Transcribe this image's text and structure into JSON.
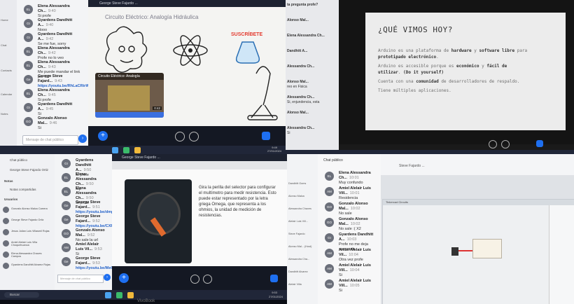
{
  "q1": {
    "chat_rows": [
      {
        "name": "Elena Alessandra Ch...",
        "time": "9:40",
        "text": "Si profe",
        "avatar": "EL"
      },
      {
        "name": "Gyardens Dandhitt A...",
        "time": "9:40",
        "text": "Nooo",
        "avatar": "GI"
      },
      {
        "name": "Gyardens Dandhitt A...",
        "time": "9:42",
        "text": "Se me fue, sorry",
        "avatar": "GI"
      },
      {
        "name": "Elena Alessandra Ch...",
        "time": "9:42",
        "text": "Profe no lo veo",
        "avatar": "EL"
      },
      {
        "name": "Elena Alessandra Ch...",
        "time": "9:43",
        "text": "Me puede mandar el link por fa?",
        "avatar": "EL"
      },
      {
        "name": "George Steve Fajard...",
        "time": "9:43",
        "text": "https://youtu.be/RhLaCRtrWH",
        "avatar": "Ge",
        "link": true
      },
      {
        "name": "Elena Alessandra Ch...",
        "time": "9:45",
        "text": "Si profe",
        "avatar": "EL"
      },
      {
        "name": "Gyardens Dandhitt A...",
        "time": "9:45",
        "text": "Si",
        "avatar": "GI"
      },
      {
        "name": "Gonzalo Alonso Mal...",
        "time": "9:46",
        "text": "Si",
        "avatar": "GO"
      }
    ],
    "sidebar_labels": [
      "Home",
      "Chat",
      "Contacts",
      "Calendar",
      "Notes"
    ],
    "input_placeholder": "Mensaje de chat público",
    "meeting_title": "George Steve Fajardo ...",
    "video_title": "Circuito Eléctrico: Analogía Hidráulica",
    "sticker_text": "SUSCRÍBETE",
    "thumb_title": "Circuito Eléctrico: Analogía",
    "thumb_time": "0:42",
    "tray_lang": "ESP\nLAA",
    "tray_time": "9:49",
    "tray_date": "27/01/2024"
  },
  "q2": {
    "chat_names": [
      "ta pregunta profe?",
      "Alonso Mal...",
      "Elena Alessandra Ch...",
      "Dandhitt A...",
      "Alessandra Ch...",
      "Alonso Mal...",
      "Alessandra Ch...",
      "Alonso Mal...",
      "Alessandra Ch..."
    ],
    "chat_snips": [
      "",
      "",
      "",
      "",
      "",
      "reo en Fisica",
      "Si, enjundencia, esta",
      "",
      "Si"
    ],
    "slide_title": "¿QUÉ VIMOS HOY?",
    "slide_lines": [
      [
        "Arduino es una plataforma de ",
        "hardware",
        " y ",
        "software libre",
        " para"
      ],
      [
        "prototipado electrónico",
        "."
      ],
      [
        "Arduino es accesible porque es ",
        "económico",
        " y ",
        "fácil de"
      ],
      [
        "utilizar",
        ". ",
        "(Do it yourself)"
      ],
      [
        "Cuenta con una ",
        "comunidad",
        " de desarrolladores de respaldo."
      ],
      [
        "Tiene múltiples aplicaciones."
      ]
    ]
  },
  "q3": {
    "meeting_title": "George Steve Fajardo ...",
    "left_nav": [
      "Chat público",
      "George Steve Fajardo Ortiz",
      "Notas",
      "Notas compartidas",
      "Usuarios"
    ],
    "users": [
      "Gonzalo Alonso Malca Carrera",
      "George Steve Fajardo Ortiz",
      "Jesus Julian Luis Villasmil Rojas",
      "Amiel Alelair Luis Villa Choquehuanca",
      "Elena Alessandra Chaves Campos",
      "Gyardens Dandhitt Alvarez Rojas"
    ],
    "chat_rows": [
      {
        "name": "Gyardens Dandhitt A...",
        "time": "9:50",
        "text": "Si profe",
        "avatar": "GI"
      },
      {
        "name": "Elena Alessandra Ch...",
        "time": "9:50",
        "text": "Sip",
        "avatar": "EL"
      },
      {
        "name": "Elena Alessandra Ch...",
        "time": "9:50",
        "text": "Si profe",
        "avatar": "EL"
      },
      {
        "name": "George Steve Fajard...",
        "time": "9:51",
        "text": "https://youtu.be/dmpfCqAddI",
        "avatar": "Ge",
        "link": true
      },
      {
        "name": "George Steve Fajard...",
        "time": "9:52",
        "text": "https://youtu.be/CXROPPvW",
        "avatar": "Ge",
        "link": true
      },
      {
        "name": "Gonzalo Alonso Mal...",
        "time": "9:52",
        "text": "No sale la url",
        "avatar": "GO"
      },
      {
        "name": "Amiel Alelair Luis Vil...",
        "time": "9:53",
        "text": "Si",
        "avatar": "AM"
      },
      {
        "name": "George Steve Fajard...",
        "time": "9:53",
        "text": "https://youtu.be/MeQ5pKfGrf",
        "avatar": "Ge",
        "link": true
      }
    ],
    "input_placeholder": "Mensaje de chat público",
    "slide_text": "Gira la perilla del selector para configurar el multímetro para medir resistencia. Esto puede estar representado por la letra griega Omega, que representa a los ohmios, la unidad de medición de resistencias.",
    "search_placeholder": "Buscar",
    "brand": "VivoBook",
    "tray_time": "9:53",
    "tray_date": "27/01/2024"
  },
  "q4": {
    "chat_header": "Chat público",
    "left_names": [
      "Dandhitt Goms",
      "Alonso Malca",
      "Alessandra Chaves",
      "Alelair Luis Vill...",
      "Steve Fajardo",
      "Alonso Mal... (Host)",
      "Alessandra Cha...",
      "Dandhitt Alvarez",
      "Alelair Villa"
    ],
    "chat_rows": [
      {
        "name": "Elena Alessandra Ch...",
        "time": "10:01",
        "text": "Muy confundo",
        "avatar": "EL"
      },
      {
        "name": "Amiel Alelair Luis Vill...",
        "time": "10:01",
        "text": "Residencia",
        "avatar": "AM"
      },
      {
        "name": "Gonzalo Alonso Mal...",
        "time": "10:02",
        "text": "No sale",
        "avatar": "GO"
      },
      {
        "name": "Gonzalo Alonso Mal...",
        "time": "10:02",
        "text": "No sale :( X2",
        "avatar": "GO"
      },
      {
        "name": "Gyardens Dandhitt A...",
        "time": "10:03",
        "text": "Profe no me deja compartir",
        "avatar": "GI"
      },
      {
        "name": "Amiel Alelair Luis Vil...",
        "time": "10:04",
        "text": "Otra vez profe",
        "avatar": "AM"
      },
      {
        "name": "Amiel Alelair Luis Vill...",
        "time": "10:04",
        "text": "Si",
        "avatar": "AM"
      },
      {
        "name": "Amiel Alelair Luis Vill...",
        "time": "10:05",
        "text": "Si",
        "avatar": "AM"
      }
    ],
    "meeting_title": "Steve Fajardo ...",
    "sim_title": "Tinkercad Circuits"
  },
  "colors": {
    "accent": "#1e6ff0",
    "link": "#2563c9",
    "slide_bg": "#ececec",
    "slide_text": "#6e6e6e"
  }
}
